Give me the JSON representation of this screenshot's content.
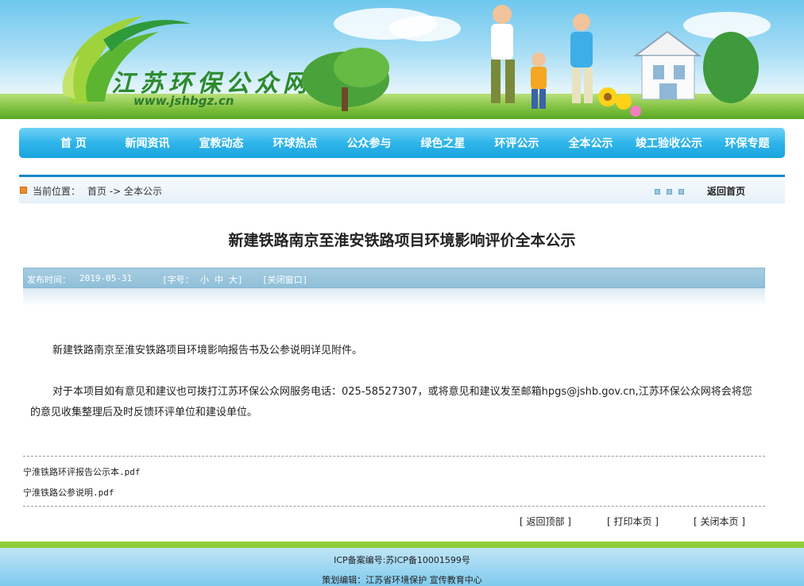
{
  "header": {
    "logo_title": "江苏环保公众网",
    "logo_url": "www.jshbgz.cn"
  },
  "nav": {
    "items": [
      "首 页",
      "新闻资讯",
      "宣教动态",
      "环球热点",
      "公众参与",
      "绿色之星",
      "环评公示",
      "全本公示",
      "竣工验收公示",
      "环保专题"
    ]
  },
  "breadcrumb": {
    "label": "当前位置：",
    "path": "首页 -> 全本公示",
    "home_back": "返回首页"
  },
  "article": {
    "title": "新建铁路南京至淮安铁路项目环境影响评价全本公示",
    "meta": {
      "publish_label": "发布时间：",
      "publish_date": "2019-05-31",
      "font_label": "[字号：",
      "font_small": "小",
      "font_medium": "中",
      "font_large": "大]",
      "close_window": "[关闭窗口]"
    },
    "paragraphs": [
      "新建铁路南京至淮安铁路项目环境影响报告书及公参说明详见附件。",
      "对于本项目如有意见和建议也可拨打江苏环保公众网服务电话：025-58527307，或将意见和建议发至邮箱hpgs@jshb.gov.cn,江苏环保公众网将会将您的意见收集整理后及时反馈环评单位和建设单位。"
    ],
    "attachments": [
      "宁淮铁路环评报告公示本.pdf",
      "宁淮铁路公参说明.pdf"
    ]
  },
  "toolbar": {
    "back_top": "[ 返回顶部 ]",
    "print": "[ 打印本页 ]",
    "close": "[ 关闭本页 ]"
  },
  "footer": {
    "icp": "ICP备案编号:苏ICP备10001599号",
    "editor": "策划编辑：江苏省环境保护 宣传教育中心"
  },
  "colors": {
    "nav_blue": "#2fb5ea",
    "meta_bar": "#9cc7df",
    "footer_green": "#8fcd3d",
    "logo_green": "#2d8a2e"
  }
}
